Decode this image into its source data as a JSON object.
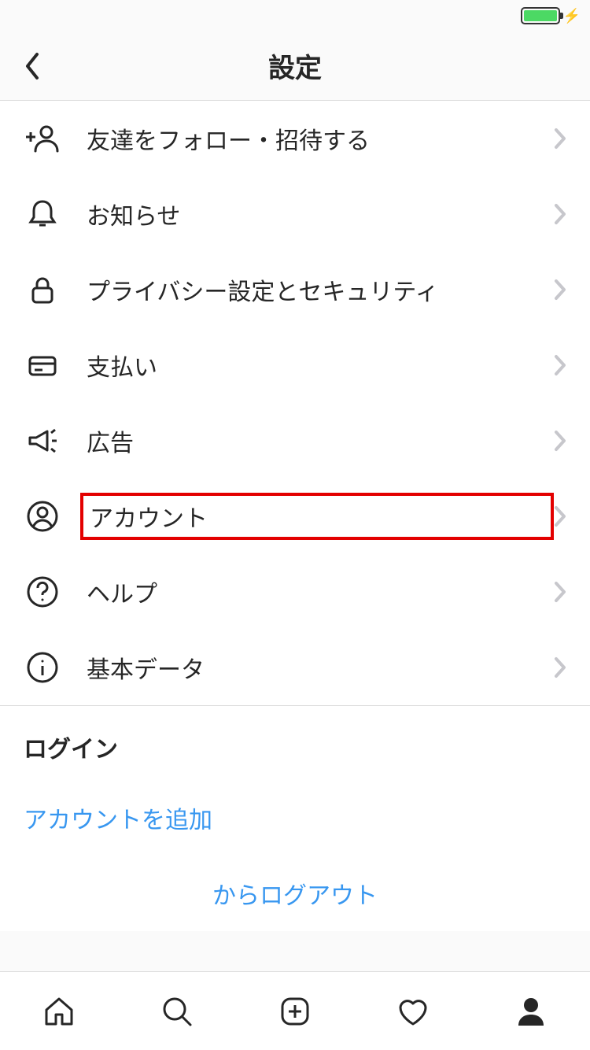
{
  "header": {
    "title": "設定"
  },
  "menu": [
    {
      "icon": "follow-invite-icon",
      "label": "友達をフォロー・招待する"
    },
    {
      "icon": "bell-icon",
      "label": "お知らせ"
    },
    {
      "icon": "lock-icon",
      "label": "プライバシー設定とセキュリティ"
    },
    {
      "icon": "card-icon",
      "label": "支払い"
    },
    {
      "icon": "megaphone-icon",
      "label": "広告"
    },
    {
      "icon": "account-icon",
      "label": "アカウント",
      "highlighted": true
    },
    {
      "icon": "help-icon",
      "label": "ヘルプ"
    },
    {
      "icon": "info-icon",
      "label": "基本データ"
    }
  ],
  "login": {
    "header": "ログイン",
    "add_account": "アカウントを追加",
    "logout": "からログアウト"
  },
  "tabs": [
    "home",
    "search",
    "add",
    "activity",
    "profile"
  ],
  "active_tab": "profile"
}
